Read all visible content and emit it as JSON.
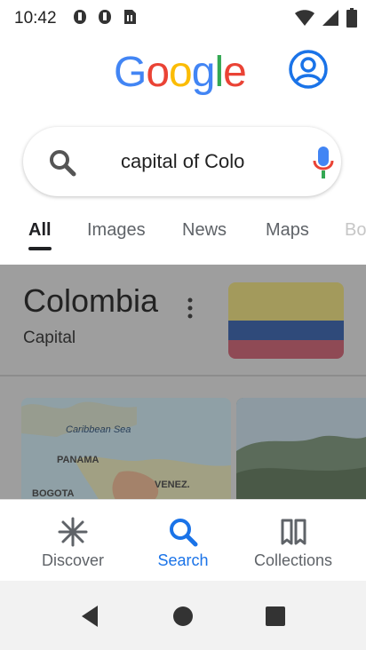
{
  "status_bar": {
    "time": "10:42",
    "icons": [
      "notification-icon",
      "notification-icon",
      "sim-card-icon",
      "wifi-icon",
      "signal-icon",
      "battery-icon"
    ]
  },
  "header": {
    "logo_letters": [
      {
        "char": "G",
        "color": "#4285F4"
      },
      {
        "char": "o",
        "color": "#EA4335"
      },
      {
        "char": "o",
        "color": "#FBBC05"
      },
      {
        "char": "g",
        "color": "#4285F4"
      },
      {
        "char": "l",
        "color": "#34A853"
      },
      {
        "char": "e",
        "color": "#EA4335"
      }
    ],
    "account_icon": "account-circle-icon"
  },
  "search": {
    "query": "capital of Colo",
    "search_icon": "search-icon",
    "mic_icon": "microphone-icon"
  },
  "tabs": [
    {
      "label": "All",
      "active": true
    },
    {
      "label": "Images",
      "active": false
    },
    {
      "label": "News",
      "active": false
    },
    {
      "label": "Maps",
      "active": false
    },
    {
      "label": "Bo",
      "active": false
    }
  ],
  "result_card": {
    "title": "Colombia",
    "subtitle": "Capital",
    "flag_colors": {
      "yellow": "#FCD116",
      "blue": "#003893",
      "red": "#CE1126"
    }
  },
  "map_labels": {
    "sea": "Caribbean Sea",
    "panama": "PANAMA",
    "bogota": "BOGOTA",
    "venez": "VENEZ."
  },
  "bottom_nav": [
    {
      "label": "Discover",
      "icon": "asterisk-icon",
      "active": false
    },
    {
      "label": "Search",
      "icon": "search-icon",
      "active": true
    },
    {
      "label": "Collections",
      "icon": "collections-icon",
      "active": false
    }
  ],
  "system_nav": [
    "back-icon",
    "home-icon",
    "recents-icon"
  ],
  "colors": {
    "accent": "#1a73e8",
    "overlay": "#9e9e9e"
  }
}
